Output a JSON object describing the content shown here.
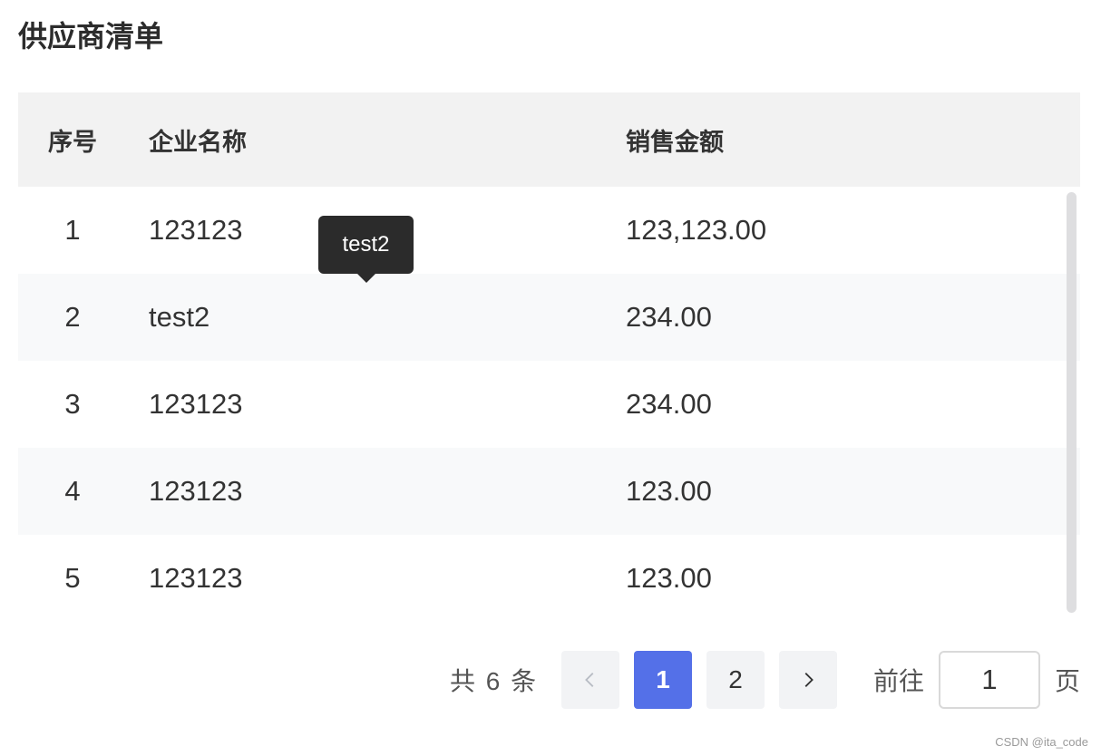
{
  "page": {
    "title": "供应商清单"
  },
  "table": {
    "headers": {
      "index": "序号",
      "name": "企业名称",
      "amount": "销售金额"
    },
    "rows": [
      {
        "index": "1",
        "name": "123123",
        "amount": "123,123.00"
      },
      {
        "index": "2",
        "name": "test2",
        "amount": "234.00"
      },
      {
        "index": "3",
        "name": "123123",
        "amount": "234.00"
      },
      {
        "index": "4",
        "name": "123123",
        "amount": "123.00"
      },
      {
        "index": "5",
        "name": "123123",
        "amount": "123.00"
      }
    ]
  },
  "tooltip": {
    "text": "test2"
  },
  "pagination": {
    "total_text": "共 6 条",
    "pages": [
      "1",
      "2"
    ],
    "current_page": "1",
    "goto_label": "前往",
    "goto_value": "1",
    "page_suffix": "页",
    "prev_icon": "chevron-left-icon",
    "next_icon": "chevron-right-icon"
  },
  "watermark": {
    "text": "CSDN @ita_code"
  },
  "colors": {
    "accent": "#5470e8",
    "header_bg": "#f2f2f2",
    "stripe_bg": "#f8f9fa",
    "tooltip_bg": "#2b2b2b"
  }
}
